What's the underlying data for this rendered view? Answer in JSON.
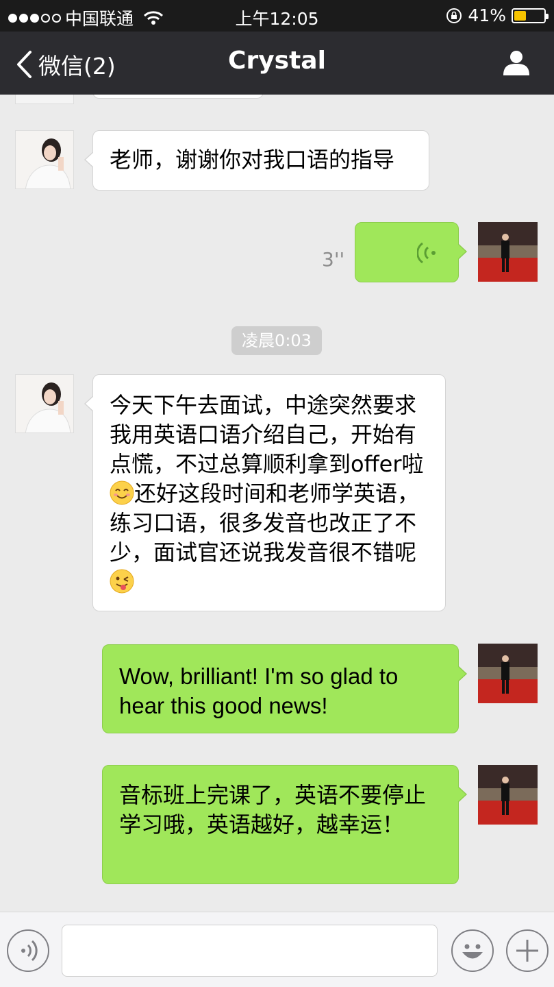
{
  "status_bar": {
    "carrier": "中国联通",
    "time": "上午12:05",
    "battery": "41%",
    "battery_level": 0.41
  },
  "nav": {
    "back_label": "微信(2)",
    "title": "Crystal"
  },
  "messages": {
    "m1": "老师，谢谢你对我口语的指导",
    "voice_duration": "3''",
    "timestamp": "凌晨0:03",
    "m2_part1": "今天下午去面试，中途突然要求我用英语口语介绍自己，开始有点慌，不过总算顺利拿到offer啦",
    "m2_part2": "还好这段时间和老师学英语，练习口语，很多发音也改正了不少，面试官还说我发音很不错呢",
    "m3": "Wow, brilliant! I'm so glad to hear this good news!",
    "m4": "音标班上完课了，英语不要停止学习哦，英语越好，越幸运！"
  },
  "icons": {
    "back": "chevron-left-icon",
    "profile": "person-icon",
    "voice": "voice-wave-icon",
    "emoji_smile": "smile-emoji-icon",
    "emoji_wink": "wink-tongue-emoji-icon",
    "voice_input": "voice-input-icon",
    "emoji_button": "emoji-icon",
    "plus": "plus-icon"
  },
  "colors": {
    "outgoing_bubble": "#a0e75a",
    "incoming_bubble": "#ffffff",
    "chat_background": "#ebebeb",
    "nav_background": "#2c2c30"
  }
}
